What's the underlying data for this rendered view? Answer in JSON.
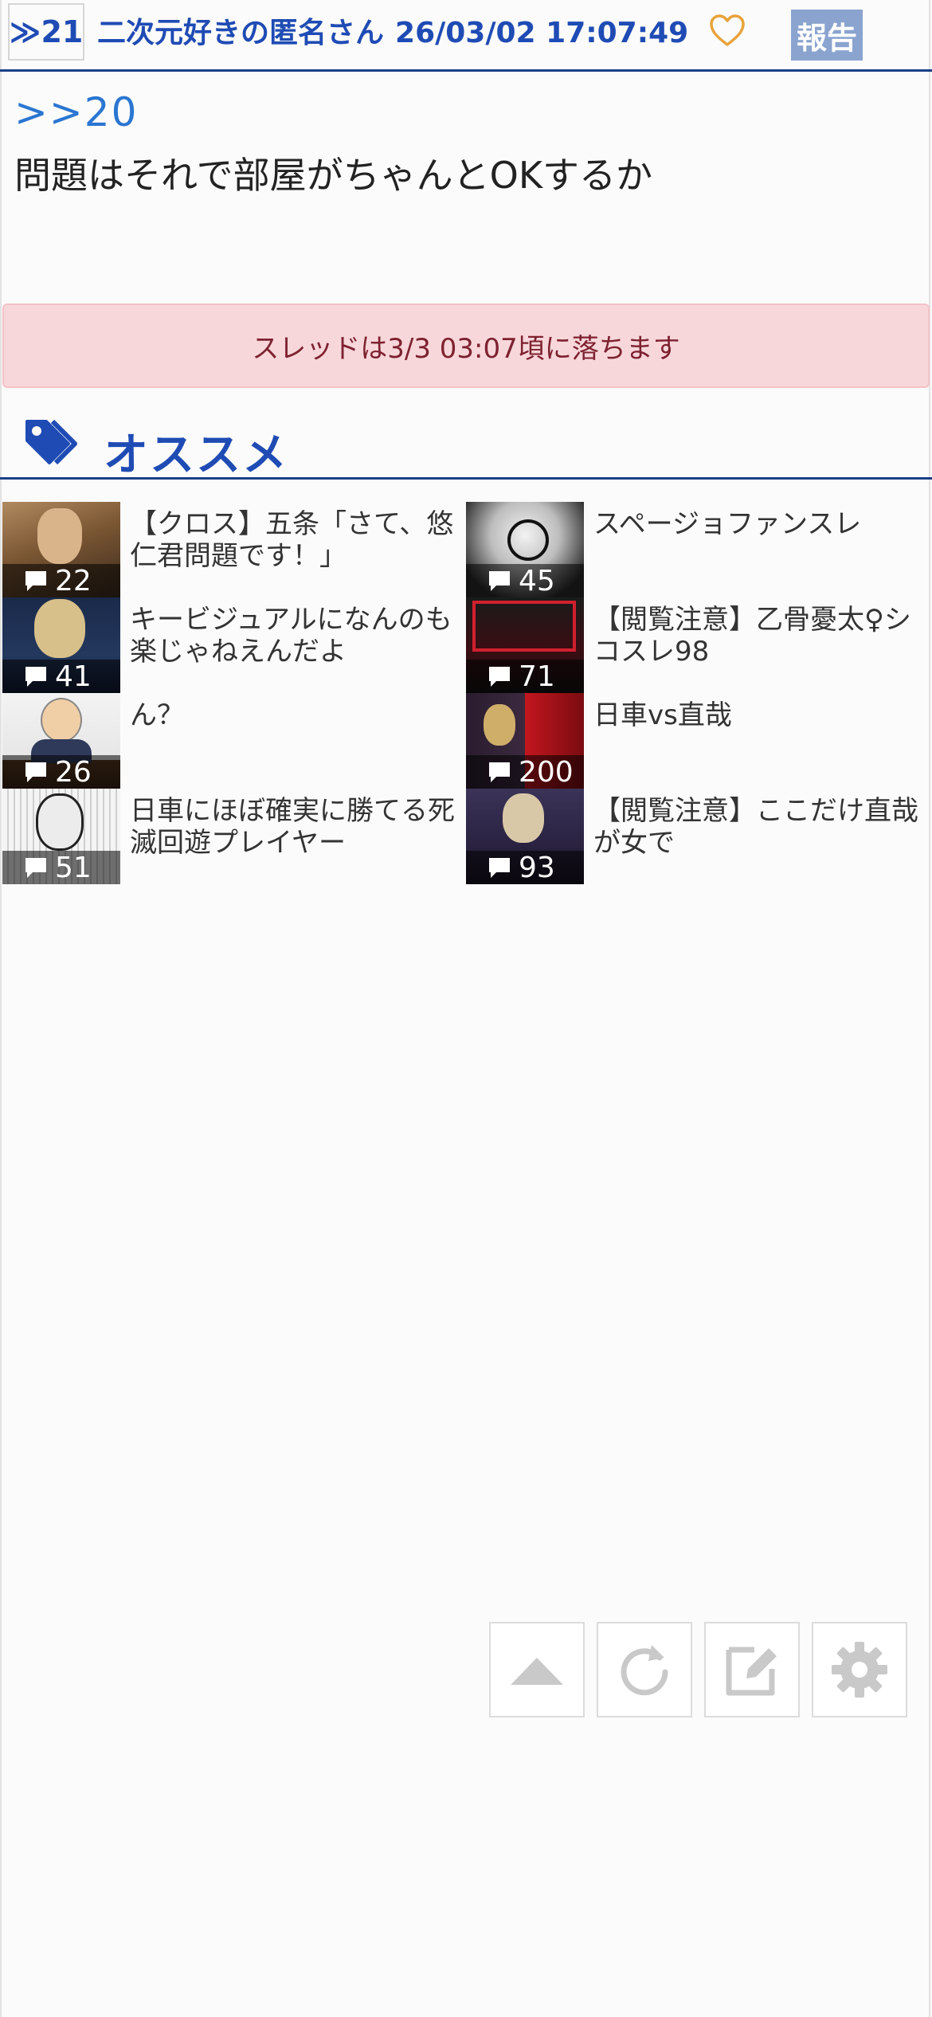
{
  "post": {
    "res_number": "≫21",
    "poster_name": "二次元好きの匿名さん",
    "datetime": "26/03/02 17:07:49",
    "report_label": "報告",
    "anchor": ">>20",
    "body": "問題はそれで部屋がちゃんとOKするか"
  },
  "notice": {
    "text": "スレッドは3/3 03:07頃に落ちます"
  },
  "recommend": {
    "title": "オススメ",
    "items": [
      {
        "title": "【クロス】五条「さて、悠仁君問題です！」",
        "count": "22"
      },
      {
        "title": "スページョファンスレ",
        "count": "45"
      },
      {
        "title": "キービジュアルになんのも楽じゃねえんだよ",
        "count": "41"
      },
      {
        "title": "【閲覧注意】乙骨憂太♀シコスレ98",
        "count": "71"
      },
      {
        "title": "ん？",
        "count": "26"
      },
      {
        "title": "日車vs直哉",
        "count": "200"
      },
      {
        "title": "日車にほぼ確実に勝てる死滅回遊プレイヤー",
        "count": "51"
      },
      {
        "title": "【閲覧注意】ここだけ直哉が女で",
        "count": "93"
      }
    ]
  },
  "icons": {
    "heart": "heart-icon",
    "tag": "tag-icon",
    "comment": "comment-icon",
    "scroll_top": "arrow-up-icon",
    "reload": "reload-icon",
    "write": "edit-icon",
    "settings": "gear-icon"
  },
  "colors": {
    "accent": "#1f4bb4",
    "link": "#2a76d1",
    "notice_bg": "#f8d7da",
    "notice_text": "#7d2130",
    "report_bg": "#8aa3cf",
    "heart": "#e8a33a"
  }
}
